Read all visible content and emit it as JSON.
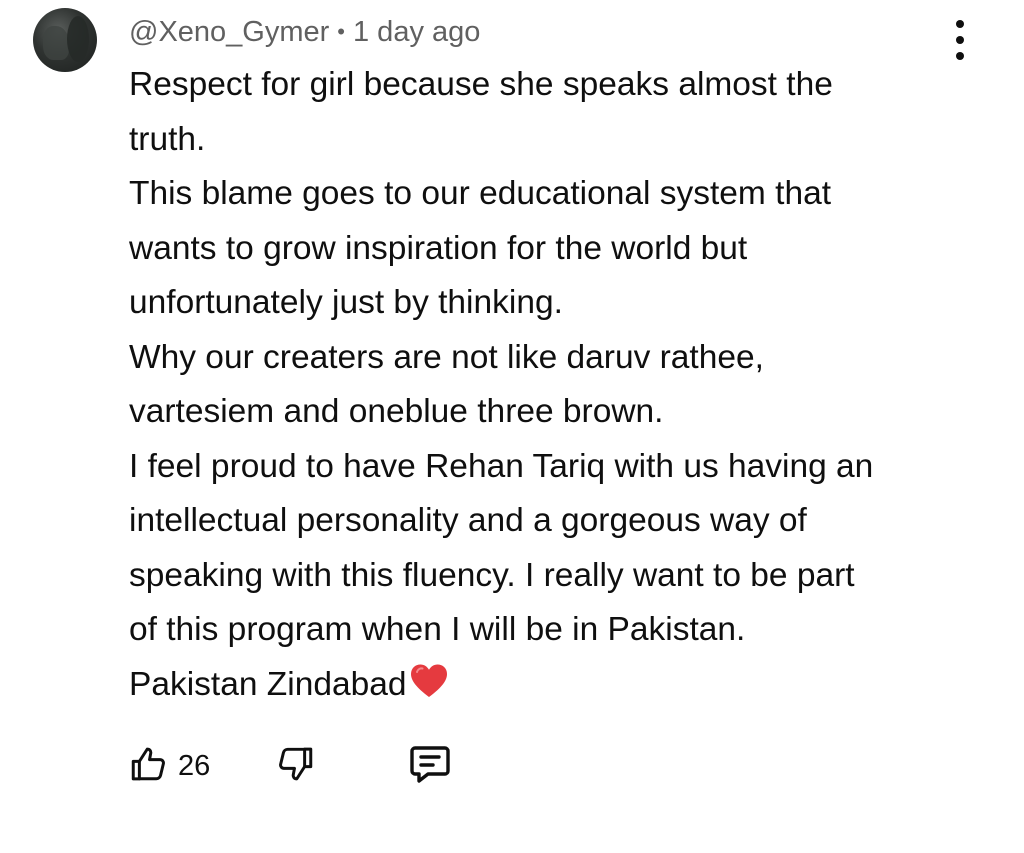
{
  "comment": {
    "author": "@Xeno_Gymer",
    "separator": "•",
    "timestamp": "1 day ago",
    "lines": [
      "Respect for girl because she speaks almost the",
      "truth.",
      "This blame goes to our educational system that",
      "wants to grow inspiration for the world but",
      "unfortunately just by thinking.",
      "Why our creaters are not like daruv rathee,",
      "vartesiem and oneblue three brown.",
      "I feel proud to have Rehan Tariq with us having an",
      "intellectual personality and a gorgeous way of",
      "speaking with this fluency. I really want to be part",
      "of this program when I will be in Pakistan.",
      "Pakistan Zindabad"
    ],
    "trailing_emoji": "red-heart-icon"
  },
  "actions": {
    "like_icon": "thumbs-up-icon",
    "like_count": "26",
    "dislike_icon": "thumbs-down-icon",
    "reply_icon": "comment-icon"
  },
  "menu": {
    "icon": "more-vertical-icon"
  },
  "colors": {
    "text": "#0f0f0f",
    "meta": "#606060",
    "heart": "#e53a3f",
    "background": "#ffffff"
  }
}
